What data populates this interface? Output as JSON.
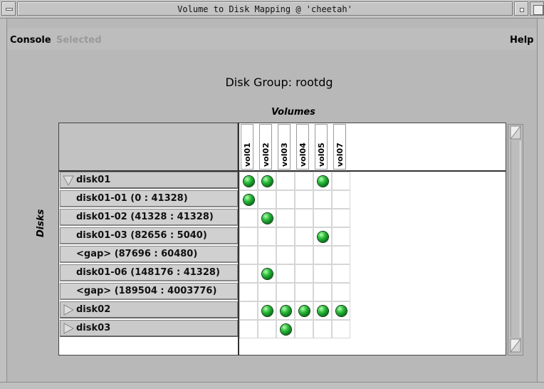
{
  "window": {
    "title": "Volume to Disk Mapping @ 'cheetah'"
  },
  "menu": {
    "console": "Console",
    "selected": "Selected",
    "help": "Help"
  },
  "heading": "Disk Group: rootdg",
  "volumes_label": "Volumes",
  "disks_label": "Disks",
  "volumes": [
    "vol01",
    "vol02",
    "vol03",
    "vol04",
    "vol05",
    "vol07"
  ],
  "rows": [
    {
      "label": "disk01",
      "type": "disk",
      "expanded": true,
      "map": [
        1,
        1,
        0,
        0,
        1,
        0
      ]
    },
    {
      "label": "disk01-01 (0 : 41328)",
      "type": "sub",
      "map": [
        1,
        0,
        0,
        0,
        0,
        0
      ]
    },
    {
      "label": "disk01-02 (41328 : 41328)",
      "type": "sub",
      "map": [
        0,
        1,
        0,
        0,
        0,
        0
      ]
    },
    {
      "label": "disk01-03 (82656 : 5040)",
      "type": "sub",
      "map": [
        0,
        0,
        0,
        0,
        1,
        0
      ]
    },
    {
      "label": "<gap> (87696 : 60480)",
      "type": "sub",
      "map": [
        0,
        0,
        0,
        0,
        0,
        0
      ]
    },
    {
      "label": "disk01-06 (148176 : 41328)",
      "type": "sub",
      "map": [
        0,
        1,
        0,
        0,
        0,
        0
      ]
    },
    {
      "label": "<gap> (189504 : 4003776)",
      "type": "sub",
      "map": [
        0,
        0,
        0,
        0,
        0,
        0
      ]
    },
    {
      "label": "disk02",
      "type": "disk",
      "expanded": false,
      "map": [
        0,
        1,
        1,
        1,
        1,
        1
      ]
    },
    {
      "label": "disk03",
      "type": "disk",
      "expanded": false,
      "map": [
        0,
        0,
        1,
        0,
        0,
        0
      ]
    }
  ],
  "colors": {
    "window_bg": "#b8b8b8",
    "status_green": "#2fbf3d",
    "menu_disabled": "#9a9a9a"
  }
}
